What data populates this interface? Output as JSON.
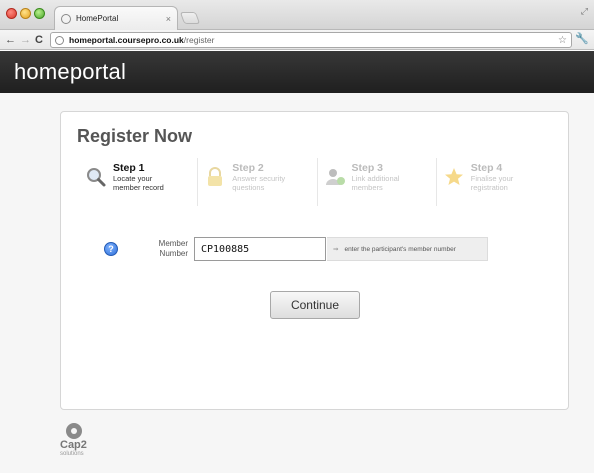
{
  "browser": {
    "tab_title": "HomePortal",
    "url_host": "homeportal.coursepro.co.uk",
    "url_path": "/register"
  },
  "site": {
    "logo": "homeportal"
  },
  "register": {
    "title": "Register Now",
    "steps": [
      {
        "label": "Step 1",
        "line1": "Locate your",
        "line2": "member record",
        "icon": "magnifier-icon",
        "active": true
      },
      {
        "label": "Step 2",
        "line1": "Answer security",
        "line2": "questions",
        "icon": "lock-icon",
        "active": false
      },
      {
        "label": "Step 3",
        "line1": "Link additional",
        "line2": "members",
        "icon": "user-add-icon",
        "active": false
      },
      {
        "label": "Step 4",
        "line1": "Finalise your",
        "line2": "registration",
        "icon": "star-icon",
        "active": false
      }
    ],
    "field_label_line1": "Member",
    "field_label_line2": "Number",
    "member_number_value": "CP100885",
    "hint": "enter the participant's member number",
    "continue_label": "Continue"
  },
  "footer": {
    "brand": "Cap2",
    "tagline": "solutions"
  },
  "colors": {
    "header_bg": "#2b2b2b",
    "help_icon": "#2f6fd8",
    "star": "#f2c24a"
  }
}
